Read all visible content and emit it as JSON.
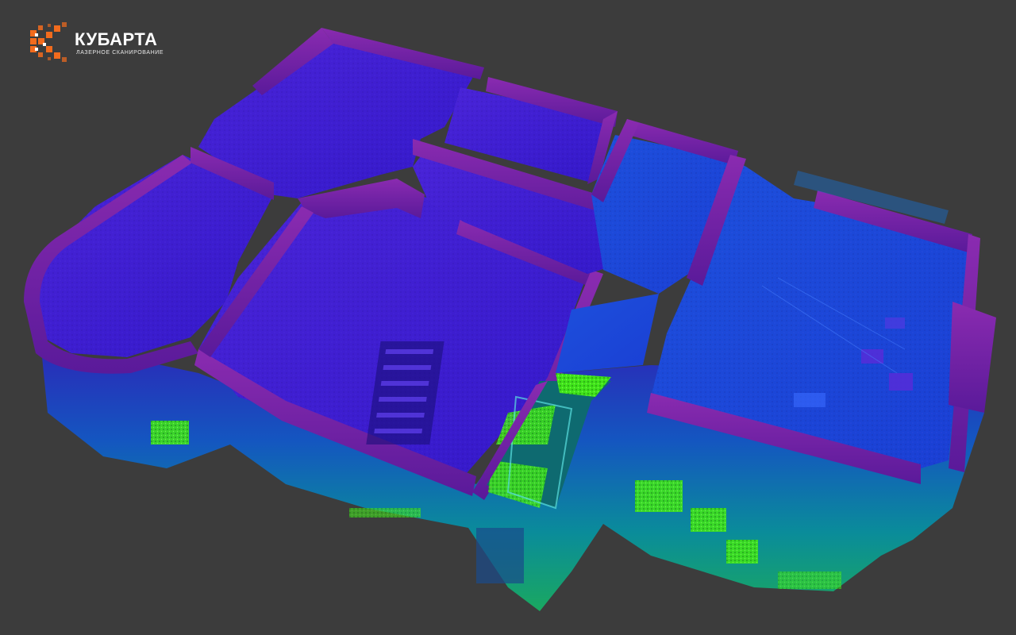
{
  "logo": {
    "name": "КУБАРТА",
    "tagline": "лазерное сканирование",
    "brand_color": "#f26b1d"
  },
  "scene": {
    "subject": "point-cloud-floor-plan",
    "background_color": "#3c3c3c",
    "colors": {
      "walls_top": "#7a1ea8",
      "floor_violet": "#3a1fd6",
      "floor_blue": "#1e4fe0",
      "lower_cyan": "#0a9a9a",
      "lower_green": "#3fe21a"
    }
  }
}
